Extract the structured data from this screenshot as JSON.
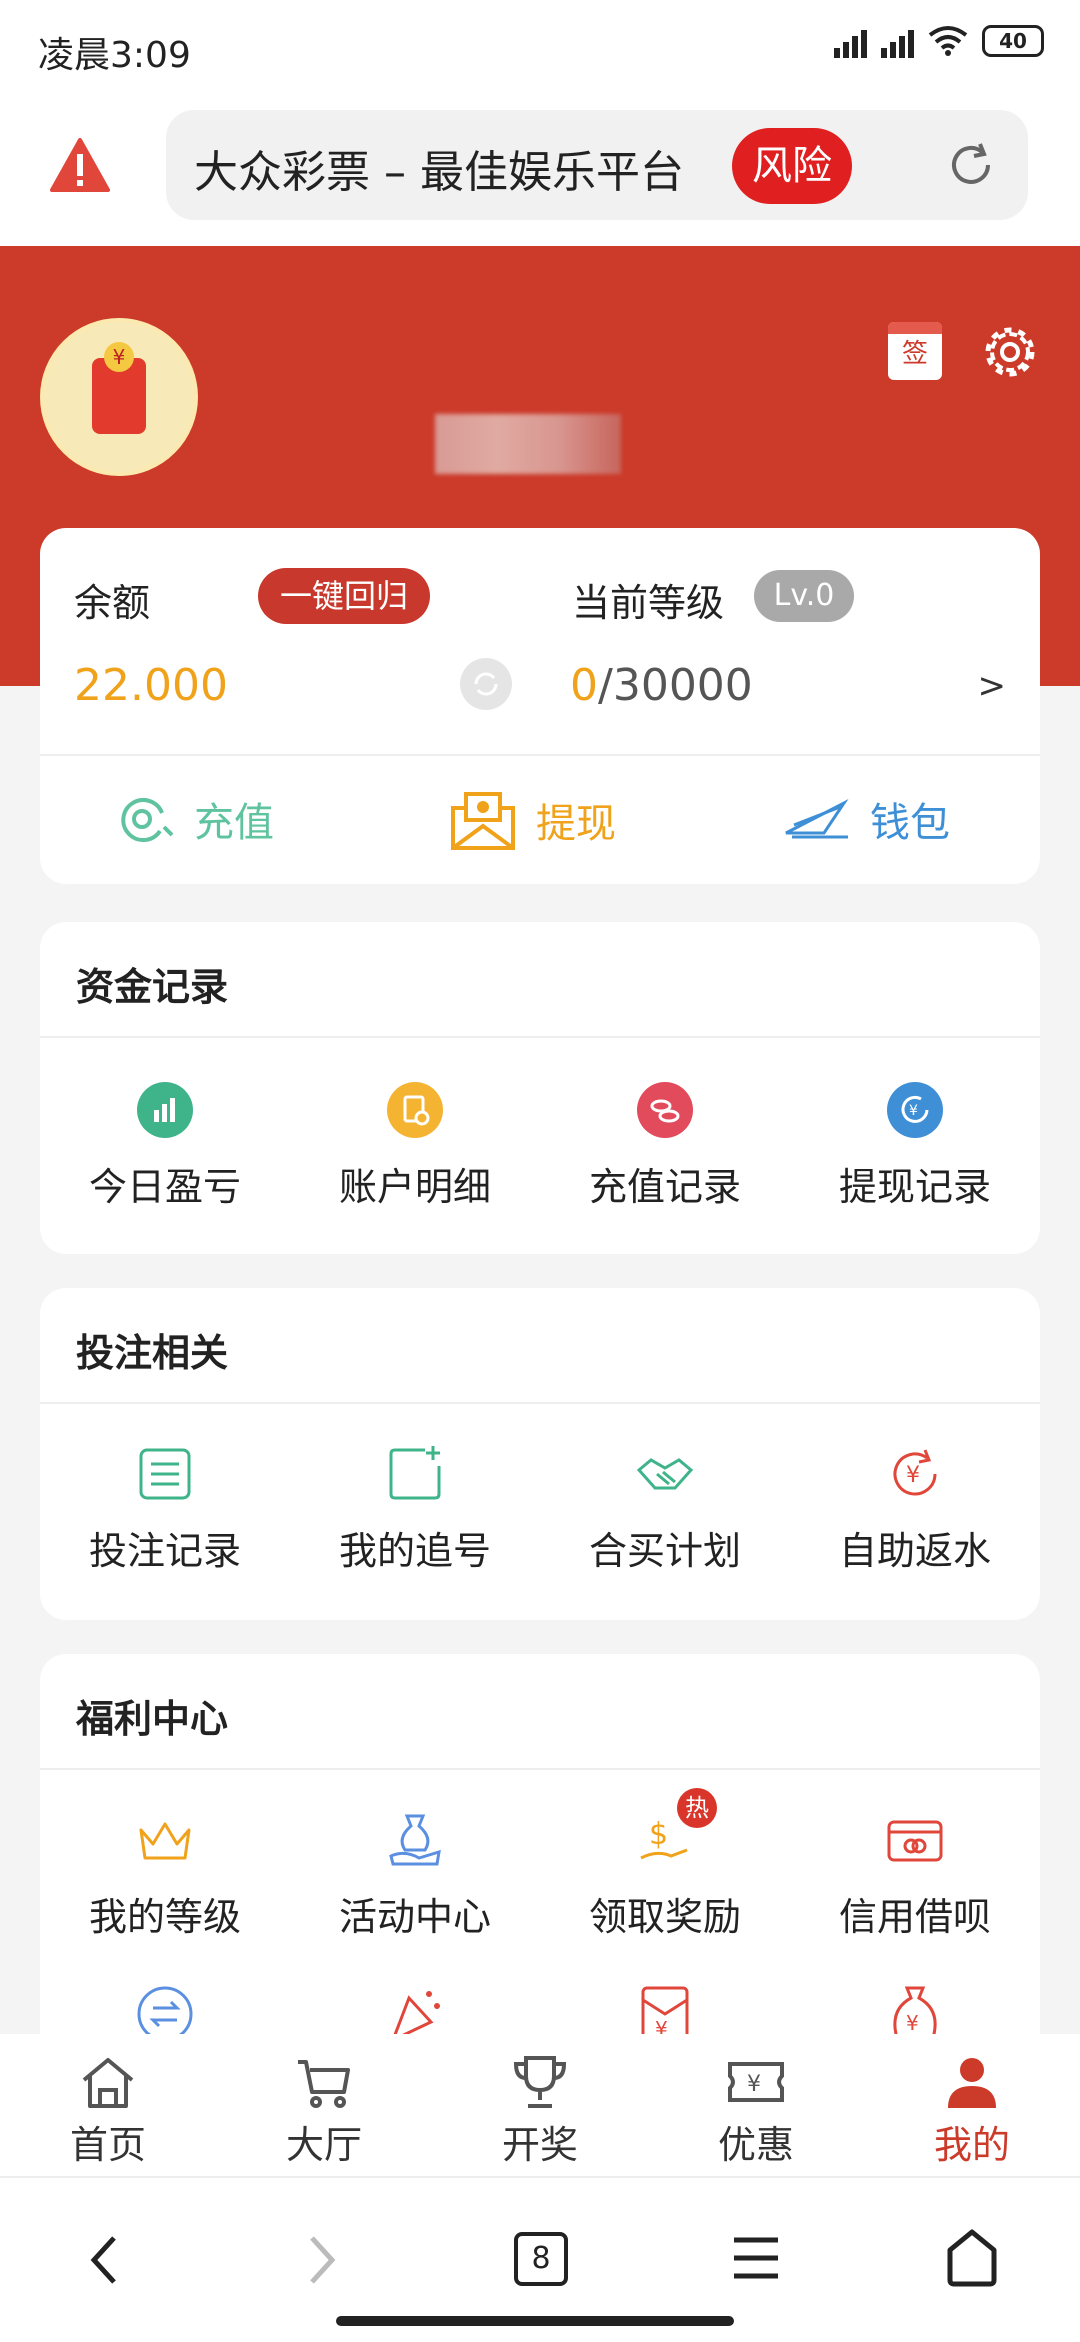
{
  "status_bar": {
    "time": "凌晨3:09",
    "battery": "40"
  },
  "url_bar": {
    "title": "大众彩票 – 最佳娱乐平台",
    "risk_badge": "风险"
  },
  "header": {
    "signin_label": "签"
  },
  "balance_card": {
    "balance_label": "余额",
    "rollback_button": "一键回归",
    "balance_value": "22.000",
    "level_label": "当前等级",
    "level_badge": "Lv.0",
    "exp_current": "0",
    "exp_total": "/30000",
    "more": ">",
    "actions": [
      {
        "label": "充值",
        "icon": "recharge-icon",
        "color": "#5fc3a0"
      },
      {
        "label": "提现",
        "icon": "withdraw-icon",
        "color": "#f0a21b"
      },
      {
        "label": "钱包",
        "icon": "wallet-icon",
        "color": "#3e8fd6"
      }
    ]
  },
  "fund_records": {
    "title": "资金记录",
    "items": [
      {
        "label": "今日盈亏",
        "icon": "chart-icon",
        "color": "#3fb48b"
      },
      {
        "label": "账户明细",
        "icon": "detail-icon",
        "color": "#f5b332"
      },
      {
        "label": "充值记录",
        "icon": "coins-icon",
        "color": "#e24b5b"
      },
      {
        "label": "提现记录",
        "icon": "yuan-transfer-icon",
        "color": "#3e8fd6"
      }
    ]
  },
  "bet_related": {
    "title": "投注相关",
    "items": [
      {
        "label": "投注记录",
        "icon": "list-icon",
        "color": "#3fb48b"
      },
      {
        "label": "我的追号",
        "icon": "add-note-icon",
        "color": "#3fb48b"
      },
      {
        "label": "合买计划",
        "icon": "handshake-icon",
        "color": "#3fb48b"
      },
      {
        "label": "自助返水",
        "icon": "yuan-refresh-icon",
        "color": "#e0463a"
      }
    ]
  },
  "welfare_center": {
    "title": "福利中心",
    "hot_badge": "热",
    "items": [
      {
        "label": "我的等级",
        "icon": "crown-icon",
        "color": "#f0a21b"
      },
      {
        "label": "活动中心",
        "icon": "moneybag-hand-icon",
        "color": "#5b8fe0"
      },
      {
        "label": "领取奖励",
        "icon": "dollar-hand-icon",
        "color": "#f0a21b"
      },
      {
        "label": "信用借呗",
        "icon": "card-icon",
        "color": "#e0463a"
      }
    ],
    "row2_icons": [
      "exchange-icon",
      "party-popper-icon",
      "red-envelope-icon",
      "yuan-bag-icon"
    ]
  },
  "tab_bar": {
    "active_color": "#cc3a2a",
    "tabs": [
      {
        "label": "首页",
        "icon": "home-icon"
      },
      {
        "label": "大厅",
        "icon": "cart-icon"
      },
      {
        "label": "开奖",
        "icon": "trophy-icon"
      },
      {
        "label": "优惠",
        "icon": "ticket-icon"
      },
      {
        "label": "我的",
        "icon": "user-icon"
      }
    ]
  },
  "nav_bar": {
    "tab_count": "8"
  }
}
